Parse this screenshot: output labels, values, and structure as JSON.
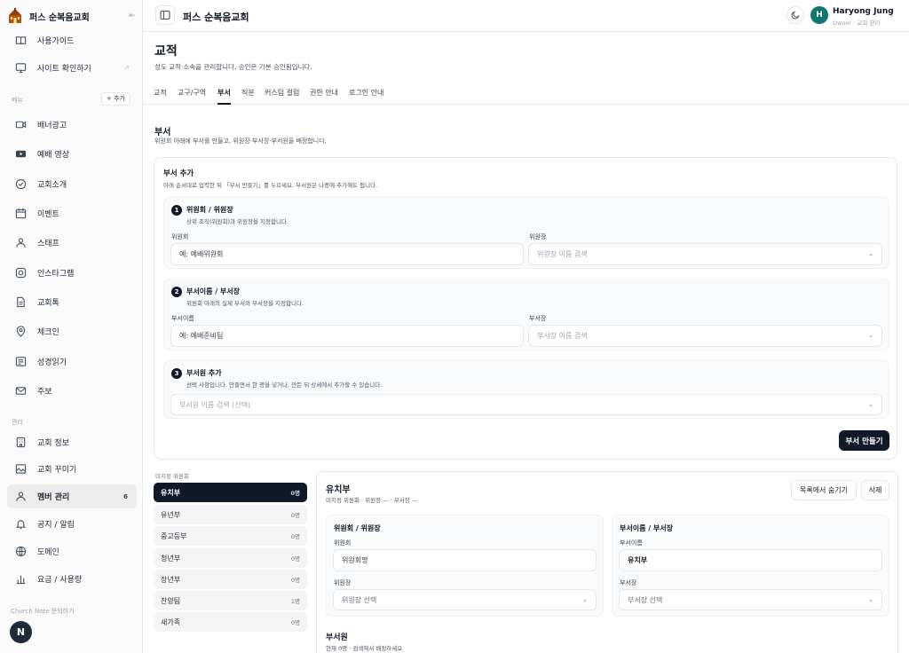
{
  "sidebar": {
    "brand_name": "퍼스 순복음교회",
    "top_items": [
      {
        "label": "사용가이드",
        "icon": "book-icon"
      },
      {
        "label": "사이트 확인하기",
        "icon": "monitor-icon"
      }
    ],
    "menu_section_label": "메뉴",
    "add_label": "+ 추가",
    "menu_items": [
      {
        "label": "배너광고",
        "icon": "video-icon"
      },
      {
        "label": "예배 영상",
        "icon": "youtube-icon"
      },
      {
        "label": "교회소개",
        "icon": "check-badge-icon"
      },
      {
        "label": "이벤트",
        "icon": "calendar-icon"
      },
      {
        "label": "스태프",
        "icon": "users-icon"
      },
      {
        "label": "인스타그램",
        "icon": "instagram-icon"
      },
      {
        "label": "교회톡",
        "icon": "document-icon"
      },
      {
        "label": "체크인",
        "icon": "location-pin-icon"
      },
      {
        "label": "성경읽기",
        "icon": "newspaper-icon"
      },
      {
        "label": "주보",
        "icon": "mail-icon"
      }
    ],
    "admin_section_label": "관리",
    "admin_items": [
      {
        "label": "교회 정보",
        "icon": "building-icon"
      },
      {
        "label": "교회 꾸미기",
        "icon": "image-icon"
      },
      {
        "label": "멤버 관리",
        "icon": "user-group-icon",
        "count": "6"
      },
      {
        "label": "공지 / 알림",
        "icon": "bell-icon"
      },
      {
        "label": "도메인",
        "icon": "globe-icon"
      },
      {
        "label": "요금 / 사용량",
        "icon": "bar-chart-icon"
      }
    ],
    "footer_link": "Church Note 문의하기",
    "avatar_letter": "N"
  },
  "header": {
    "title": "퍼스 순복음교회",
    "user": {
      "initial": "H",
      "name": "Haryong Jung",
      "role": "Owner · 교회 관리"
    }
  },
  "page": {
    "title": "교적",
    "description": "성도 교적·소속을 관리합니다. 승인은 기본 승인됨입니다.",
    "tabs": [
      {
        "label": "교적"
      },
      {
        "label": "교구/구역"
      },
      {
        "label": "부서"
      },
      {
        "label": "직분"
      },
      {
        "label": "커스텀 컬럼"
      },
      {
        "label": "권한 안내"
      },
      {
        "label": "로그인 안내"
      }
    ]
  },
  "section": {
    "title": "부서",
    "description": "위원회 아래에 부서를 만들고, 위원장·부서장·부서원을 배정합니다."
  },
  "add_form": {
    "title": "부서 추가",
    "description": "아래 순서대로 입력한 뒤 「부서 만들기」를 누르세요. 부서원은 나중에 추가해도 됩니다.",
    "step1": {
      "num": "1",
      "title": "위원회 / 위원장",
      "desc": "상위 조직(위원회)과 위원장을 지정합니다.",
      "committee_label": "위원회",
      "committee_placeholder": "예: 예배위원회",
      "chair_label": "위원장",
      "chair_placeholder": "위원장 이름 검색"
    },
    "step2": {
      "num": "2",
      "title": "부서이름 / 부서장",
      "desc": "위원회 아래의 실제 부서와 부서장을 지정합니다.",
      "dept_label": "부서이름",
      "dept_placeholder": "예: 예배준비팀",
      "head_label": "부서장",
      "head_placeholder": "부서장 이름 검색"
    },
    "step3": {
      "num": "3",
      "title": "부서원 추가",
      "desc": "선택 사항입니다. 만들면서 한 명을 넣거나, 만든 뒤 상세에서 추가할 수 있습니다.",
      "member_placeholder": "부서원 이름 검색 (선택)"
    },
    "submit_label": "부서 만들기"
  },
  "dept_list": {
    "group_label": "미지정 위원회",
    "items": [
      {
        "name": "유치부",
        "count": "0명"
      },
      {
        "name": "유년부",
        "count": "0명"
      },
      {
        "name": "중고등부",
        "count": "0명"
      },
      {
        "name": "청년부",
        "count": "0명"
      },
      {
        "name": "장년부",
        "count": "0명"
      },
      {
        "name": "찬양팀",
        "count": "1명"
      },
      {
        "name": "새가족",
        "count": "0명"
      }
    ]
  },
  "detail": {
    "title": "유치부",
    "meta": "미지정 위원회 · 위원장 — · 부서장 —",
    "hide_label": "목록에서 숨기기",
    "delete_label": "삭제",
    "left": {
      "title": "위원회 / 위원장",
      "committee_label": "위원회",
      "committee_value": "위원회명",
      "chair_label": "위원장",
      "chair_placeholder": "위원장 선택"
    },
    "right": {
      "title": "부서이름 / 부서장",
      "dept_label": "부서이름",
      "dept_value": "유치부",
      "head_label": "부서장",
      "head_placeholder": "부서장 선택"
    },
    "members_title": "부서원",
    "members_meta": "현재 0명 · 검색해서 배정하세요"
  }
}
